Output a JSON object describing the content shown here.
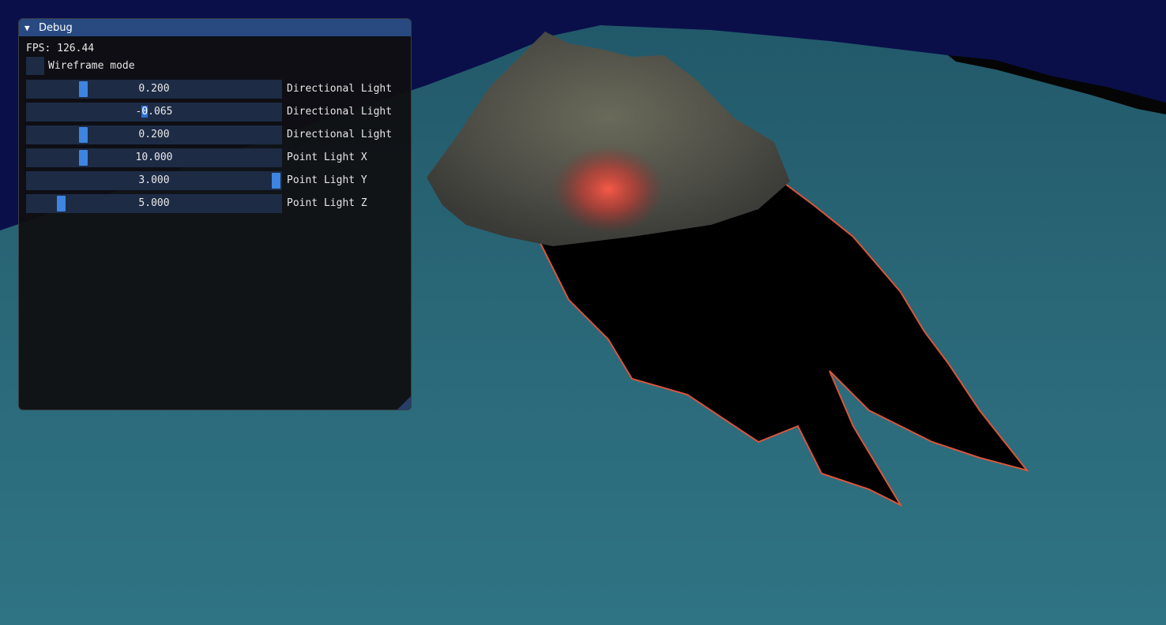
{
  "window": {
    "title": "Debug",
    "collapse_glyph": "▼"
  },
  "fps": {
    "label": "FPS: ",
    "value": "126.44"
  },
  "wireframe": {
    "label": "Wireframe mode",
    "checked": false
  },
  "sliders": [
    {
      "label": "Directional Light",
      "value": "0.200",
      "fraction": 0.21
    },
    {
      "label": "Directional Light",
      "value": "-0.065",
      "fraction": null,
      "editing": true,
      "value_before": "-",
      "value_selected": "0",
      "value_after": ".065"
    },
    {
      "label": "Directional Light",
      "value": "0.200",
      "fraction": 0.21
    },
    {
      "label": "Point Light X",
      "value": "10.000",
      "fraction": 0.21
    },
    {
      "label": "Point Light Y",
      "value": "3.000",
      "fraction": 1.0
    },
    {
      "label": "Point Light Z",
      "value": "5.000",
      "fraction": 0.12
    }
  ],
  "icons": {
    "collapse": "chevron-down-icon",
    "resize": "resize-grip-icon"
  },
  "colors": {
    "sky": "#0a0f4a",
    "water": "#2a6878",
    "title_bar": "#284a80",
    "slider_bg": "#1d2b45",
    "slider_grab": "#3d85e0",
    "point_light_glow": "#ff4a3a"
  }
}
